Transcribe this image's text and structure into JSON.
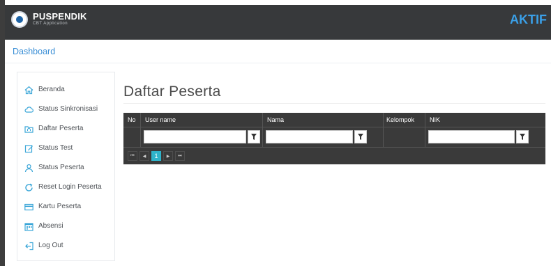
{
  "header": {
    "brand_title": "PUSPENDIK",
    "brand_subtitle": "CBT Application",
    "status": "AKTIF"
  },
  "breadcrumb": {
    "label": "Dashboard"
  },
  "sidebar": {
    "items": [
      {
        "label": "Beranda",
        "icon": "home-icon"
      },
      {
        "label": "Status Sinkronisasi",
        "icon": "cloud-icon"
      },
      {
        "label": "Daftar Peserta",
        "icon": "folder-icon"
      },
      {
        "label": "Status Test",
        "icon": "edit-icon"
      },
      {
        "label": "Status Peserta",
        "icon": "user-icon"
      },
      {
        "label": "Reset Login Peserta",
        "icon": "refresh-icon"
      },
      {
        "label": "Kartu Peserta",
        "icon": "card-icon"
      },
      {
        "label": "Absensi",
        "icon": "calendar-icon"
      },
      {
        "label": "Log Out",
        "icon": "logout-icon"
      }
    ]
  },
  "main": {
    "title": "Daftar Peserta",
    "grid": {
      "columns": [
        "No",
        "User name",
        "Nama",
        "Kelompok",
        "NIK"
      ],
      "filters": {
        "username": "",
        "nama": "",
        "nik": ""
      },
      "pager": {
        "first": "⏮",
        "prev": "◀",
        "current_page": "1",
        "next": "▶",
        "last": "⏭"
      }
    }
  },
  "colors": {
    "topbar": "#37393b",
    "accent": "#3aa0e8",
    "grid_header": "#3a3a3a",
    "pager_active": "#2fb3c9",
    "sidebar_icon": "#3aa6d8"
  }
}
